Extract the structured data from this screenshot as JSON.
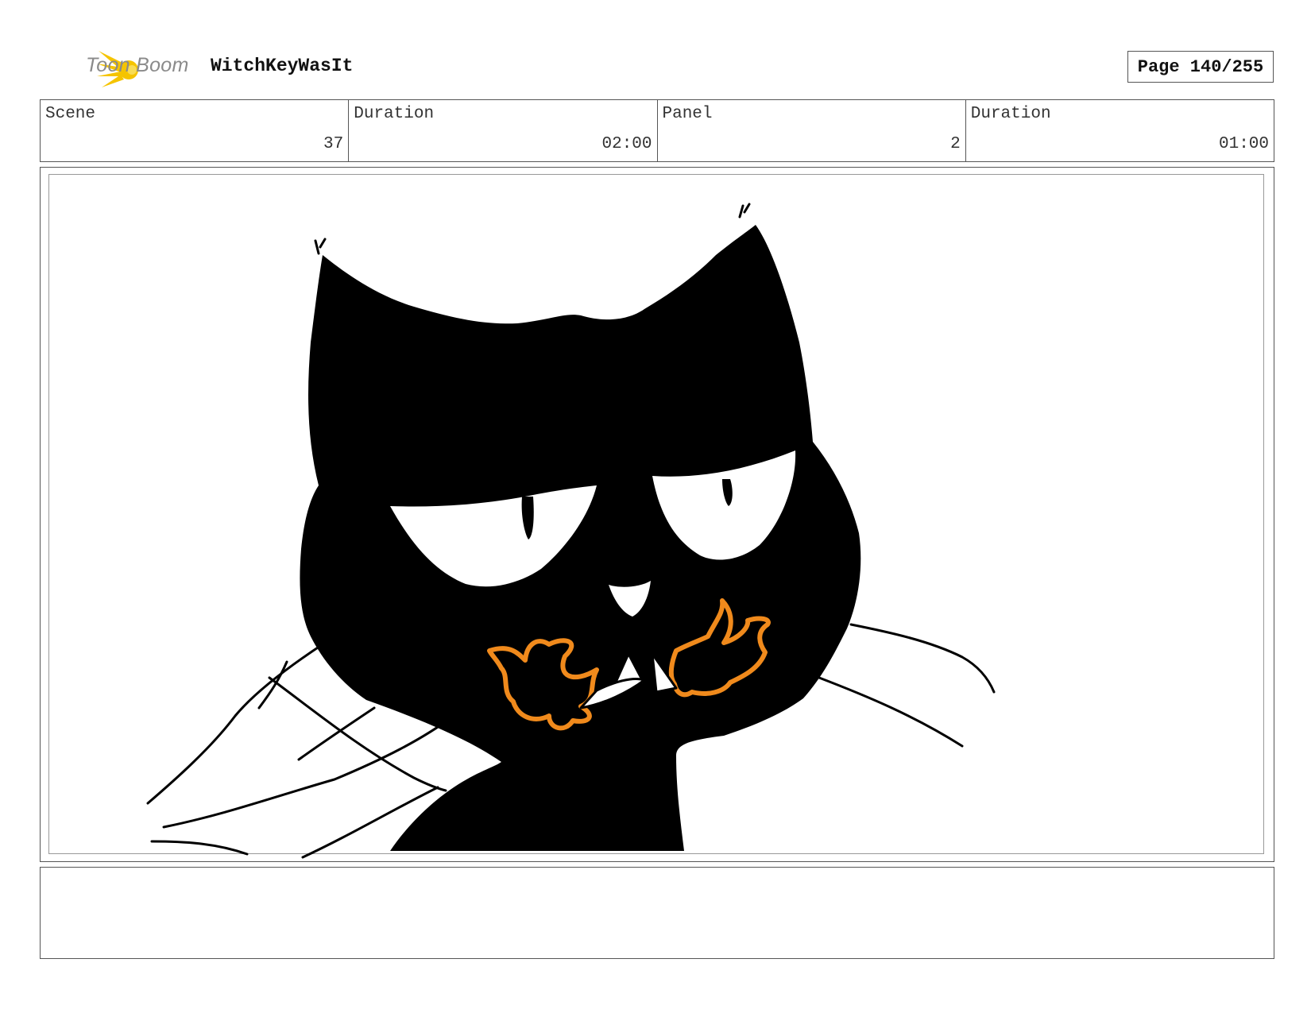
{
  "header": {
    "logo_text": "Toon Boom",
    "project_title": "WitchKeyWasIt",
    "page_label": "Page 140/255"
  },
  "info": [
    {
      "label": "Scene",
      "value": "37"
    },
    {
      "label": "Duration",
      "value": "02:00"
    },
    {
      "label": "Panel",
      "value": "2"
    },
    {
      "label": "Duration",
      "value": "01:00"
    }
  ],
  "panel": {
    "image": "black-cat-with-fire-mouth-sketch",
    "colors": {
      "fur": "#000000",
      "fire": "#f08a1c",
      "eyes": "#ffffff"
    }
  },
  "notes": {
    "text": ""
  }
}
